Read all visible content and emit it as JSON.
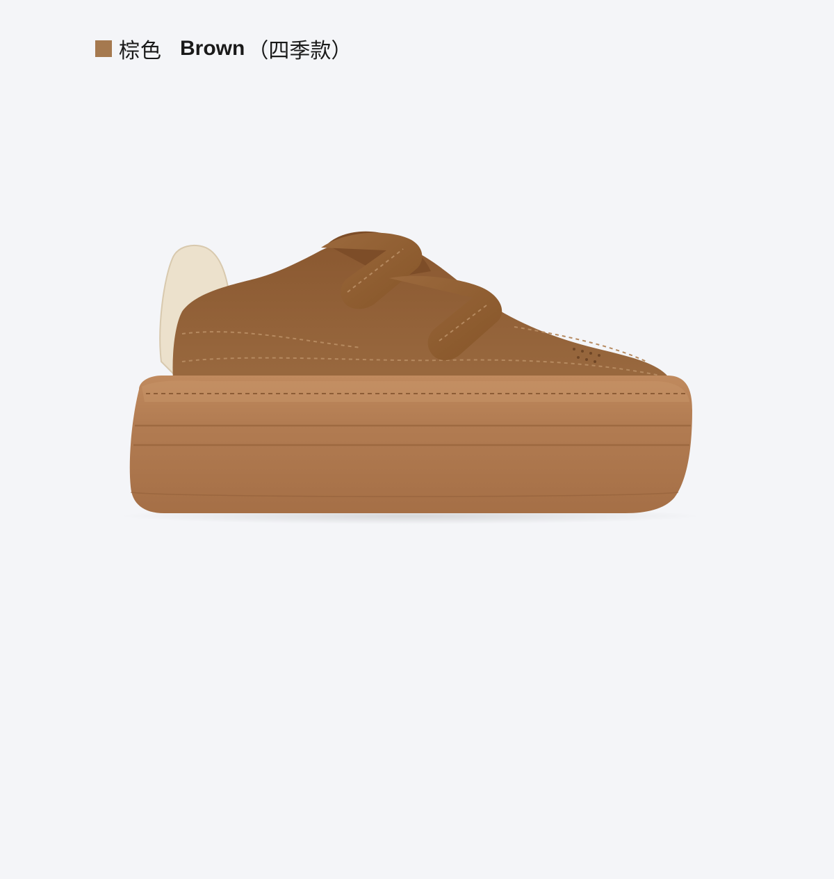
{
  "variant": {
    "name_cn": "棕色",
    "name_en": "Brown",
    "season": "（四季款）",
    "swatch_color": "#a5794f"
  },
  "colors": {
    "background": "#f4f5f8",
    "suede_upper": "#8f5d34",
    "suede_shadow": "#6f4626",
    "sole": "#b27c52",
    "sole_dark": "#8d5c36",
    "heel_tab": "#ece1cc"
  },
  "product": {
    "image_description_icon": "platform-velcro-sneaker-image"
  }
}
